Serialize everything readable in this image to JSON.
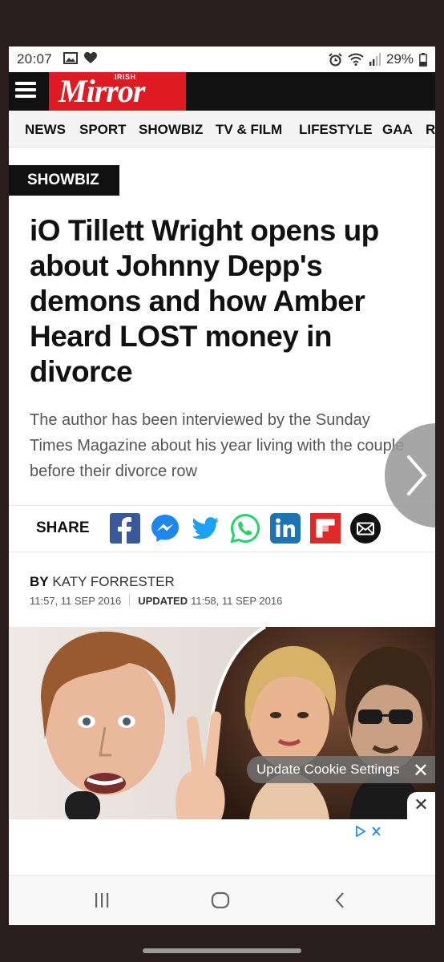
{
  "status_bar": {
    "time": "20:07",
    "battery": "29%",
    "left_icons": [
      "gallery-icon",
      "heart-icon"
    ],
    "right_icons": [
      "alarm-icon",
      "wifi-icon",
      "signal-icon",
      "battery-icon"
    ]
  },
  "header": {
    "logo_sub": "IRISH",
    "logo": "Mirror",
    "brand_color": "#e01a22"
  },
  "nav": {
    "items": [
      "NEWS",
      "SPORT",
      "SHOWBIZ",
      "TV & FILM",
      "LIFESTYLE",
      "GAA",
      "R"
    ]
  },
  "article": {
    "section": "SHOWBIZ",
    "headline": "iO Tillett Wright opens up about Johnny Depp's demons and how Amber Heard LOST money in divorce",
    "standfirst": "The author has been interviewed by the Sunday Times Magazine about his year living with the couple before their divorce row",
    "share_label": "SHARE",
    "share_icons": [
      "facebook-icon",
      "messenger-icon",
      "twitter-icon",
      "whatsapp-icon",
      "linkedin-icon",
      "flipboard-icon",
      "email-icon"
    ],
    "byline_prefix": "BY",
    "author": "KATY FORRESTER",
    "published": "11:57, 11 SEP 2016",
    "updated_label": "UPDATED",
    "updated": "11:58, 11 SEP 2016"
  },
  "overlays": {
    "cookie_settings": "Update Cookie Settings",
    "close_glyph": "✕"
  }
}
